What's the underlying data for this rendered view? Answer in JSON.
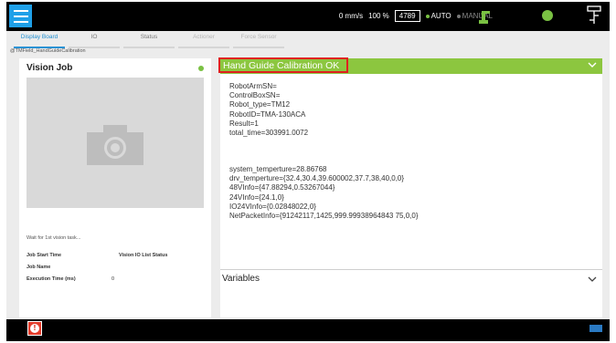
{
  "topbar": {
    "speed": "0 mm/s",
    "percent": "100 %",
    "count": "4789",
    "mode_auto": "AUTO",
    "mode_manual": "MANUAL"
  },
  "tabs": [
    {
      "label": "Display Board"
    },
    {
      "label": "IO"
    },
    {
      "label": "Status"
    },
    {
      "label": "Actioner"
    },
    {
      "label": "Force Sensor"
    }
  ],
  "breadcrumb": "@TMField_HandGuideCalibration",
  "left_panel": {
    "title": "Vision Job",
    "wait_text": "Wait for 1st vision task...",
    "job_start_time_label": "Job Start Time",
    "vision_io_label": "Vision IO List Status",
    "job_name_label": "Job Name",
    "exec_time_label": "Execution Time (ms)",
    "exec_time_value": "0"
  },
  "right_panel": {
    "title": "Hand Guide Calibration OK",
    "result_block1": [
      "RobotArmSN=",
      "ControlBoxSN=",
      "Robot_type=TM12",
      "RobotID=TMA-130ACA",
      "Result=1",
      "total_time=303991.0072"
    ],
    "result_block2": [
      "system_temperture=28.86768",
      "drv_temperture={32.4,30.4,39.600002,37.7,38,40,0,0}",
      "48VInfo={47.88294,0.53267044}",
      "24VInfo={24.1,0}",
      "IO24VInfo={0.02848022,0}",
      "NetPacketInfo={91242117,1425,999.99938964843 75,0,0}"
    ],
    "variables_label": "Variables"
  },
  "colors": {
    "accent_blue": "#1fa0e8",
    "green": "#8cc63f",
    "highlight_red": "#e02020",
    "alert_red": "#e23b2a"
  },
  "icons": {
    "menu": "hamburger-menu-icon",
    "robot": "robot-arm-icon",
    "tree": "project-tree-icon",
    "camera": "camera-icon",
    "chevron": "chevron-down-icon",
    "alert": "alert-icon"
  }
}
